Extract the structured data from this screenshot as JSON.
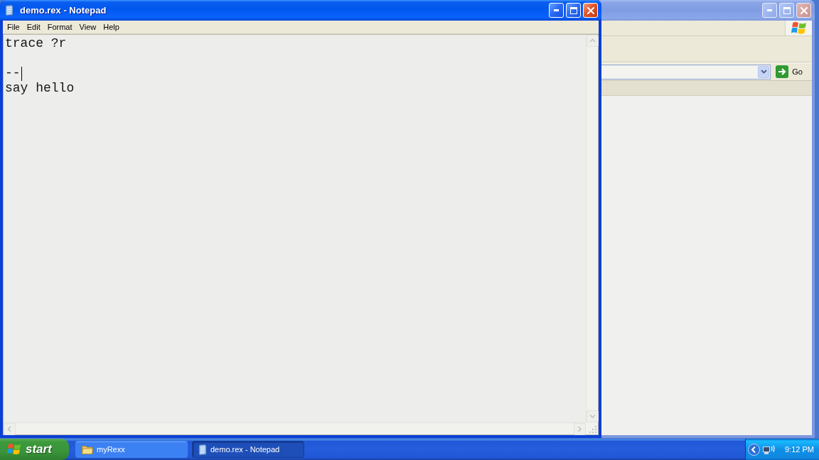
{
  "background_window": {
    "active": false,
    "go_button": "Go"
  },
  "notepad": {
    "title": "demo.rex - Notepad",
    "active": true,
    "menu": [
      "File",
      "Edit",
      "Format",
      "View",
      "Help"
    ],
    "lines": [
      {
        "kind": "text",
        "text": "trace ?r",
        "caret": false
      },
      {
        "kind": "blank",
        "caret": false
      },
      {
        "kind": "text",
        "text": "--",
        "caret": true
      },
      {
        "kind": "text",
        "text": "say hello",
        "caret": false
      }
    ]
  },
  "taskbar": {
    "start": "start",
    "tasks": [
      {
        "kind": "folder",
        "label": "myRexx",
        "selected": false
      },
      {
        "kind": "notepad",
        "label": "demo.rex - Notepad",
        "selected": true
      }
    ],
    "clock": "9:12 PM"
  }
}
